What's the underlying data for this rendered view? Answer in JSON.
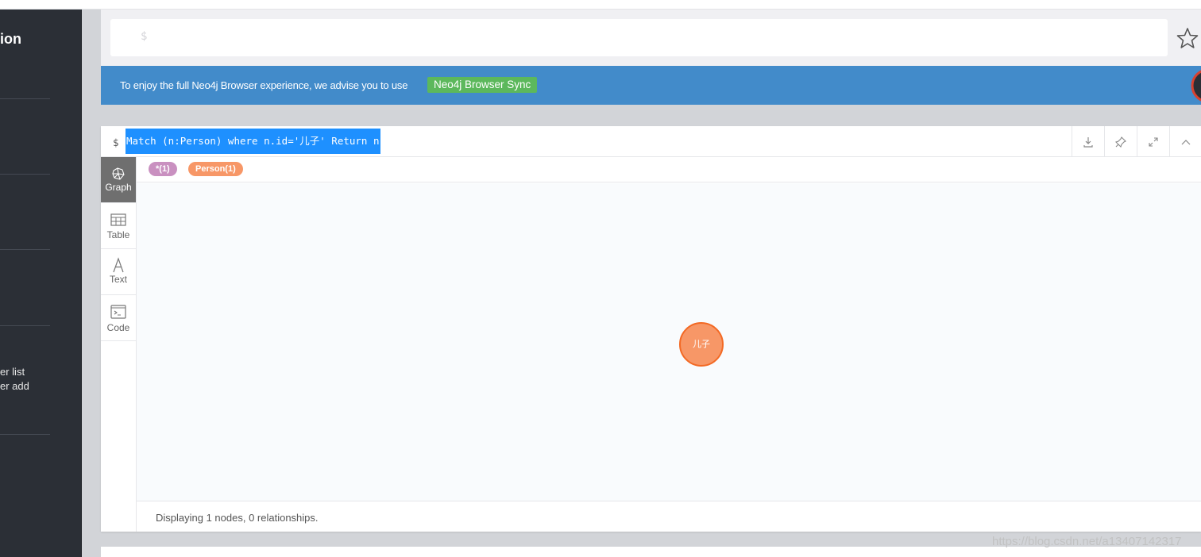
{
  "sidebar": {
    "title": "ion",
    "links": [
      "er list",
      "er add"
    ]
  },
  "editor": {
    "prompt": "$"
  },
  "banner": {
    "message": "To enjoy the full Neo4j Browser experience, we advise you to use",
    "sync_label": "Neo4j Browser Sync",
    "color": "#428bca"
  },
  "frame": {
    "dollar": "$",
    "query": "Match (n:Person) where n.id='儿子' Return n",
    "tabs": [
      {
        "label": "Graph",
        "icon": "graph-icon"
      },
      {
        "label": "Table",
        "icon": "table-icon"
      },
      {
        "label": "Text",
        "icon": "text-icon"
      },
      {
        "label": "Code",
        "icon": "code-icon"
      }
    ],
    "legend": [
      {
        "label": "*(1)",
        "color": "#c990c0"
      },
      {
        "label": "Person(1)",
        "color": "#f79767"
      }
    ],
    "node_label": "儿子",
    "status": "Displaying 1 nodes, 0 relationships."
  },
  "watermark": "https://blog.csdn.net/a13407142317"
}
